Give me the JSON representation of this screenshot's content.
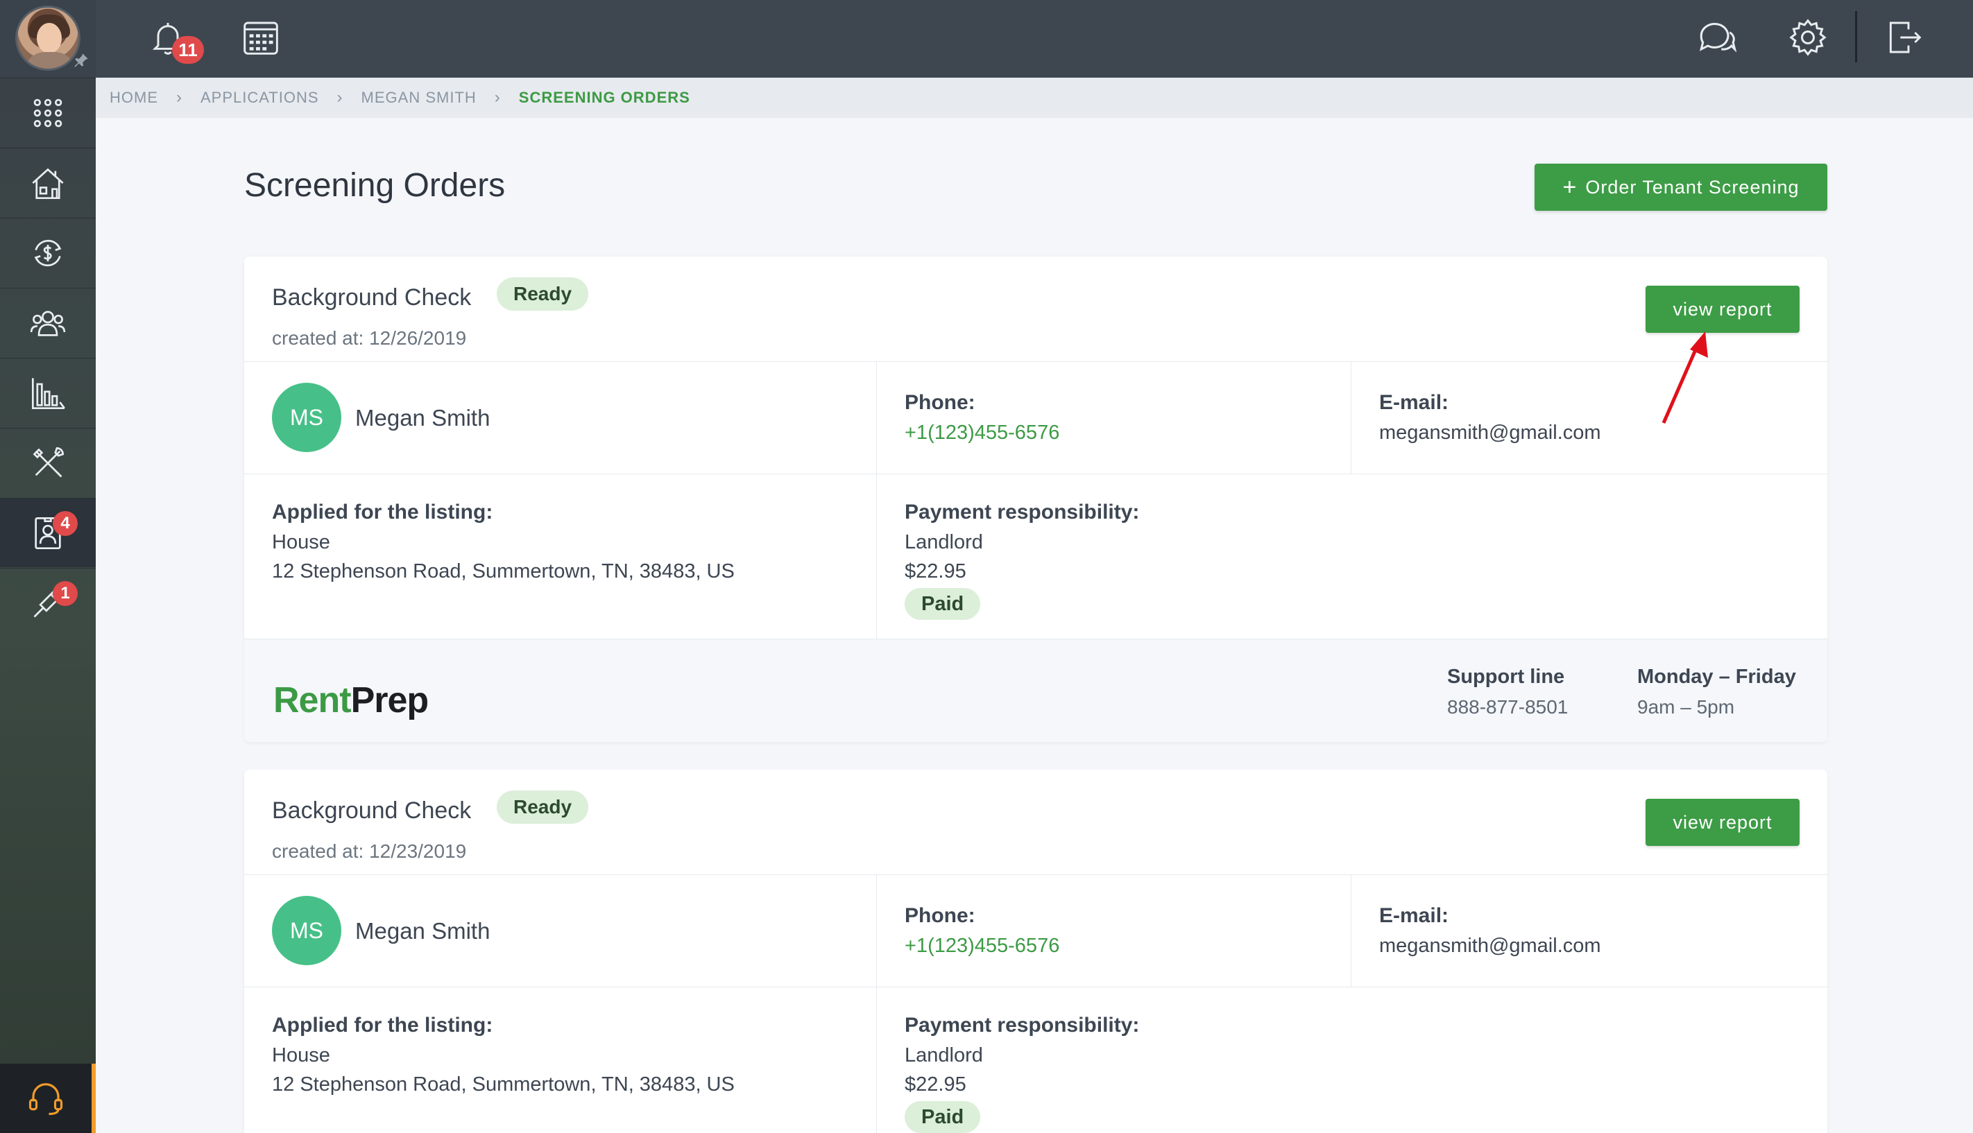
{
  "topbar": {
    "notification_count": "11"
  },
  "sidebar": {
    "items": [
      {
        "icon": "apps-grid-icon"
      },
      {
        "icon": "properties-icon"
      },
      {
        "icon": "accounting-icon"
      },
      {
        "icon": "people-icon"
      },
      {
        "icon": "reports-icon"
      },
      {
        "icon": "maintenance-icon"
      },
      {
        "icon": "applications-icon",
        "badge": "4"
      },
      {
        "icon": "tools-icon",
        "badge": "1"
      }
    ]
  },
  "breadcrumb": [
    "HOME",
    "APPLICATIONS",
    "MEGAN SMITH",
    "SCREENING ORDERS"
  ],
  "page": {
    "title": "Screening Orders",
    "order_button": "Order Tenant Screening"
  },
  "labels": {
    "phone": "Phone:",
    "email": "E-mail:",
    "listing": "Applied for the listing:",
    "payment": "Payment responsibility:",
    "view_report": "view report",
    "support_line": "Support line",
    "hours_label": "Monday – Friday"
  },
  "orders": [
    {
      "title": "Background Check",
      "status": "Ready",
      "created": "created at: 12/26/2019",
      "initials": "MS",
      "name": "Megan Smith",
      "phone": "+1(123)455-6576",
      "email": "megansmith@gmail.com",
      "listing_type": "House",
      "listing_address": "12 Stephenson Road, Summertown, TN, 38483, US",
      "payer": "Landlord",
      "amount": "$22.95",
      "payment_status": "Paid"
    },
    {
      "title": "Background Check",
      "status": "Ready",
      "created": "created at: 12/23/2019",
      "initials": "MS",
      "name": "Megan Smith",
      "phone": "+1(123)455-6576",
      "email": "megansmith@gmail.com",
      "listing_type": "House",
      "listing_address": "12 Stephenson Road, Summertown, TN, 38483, US",
      "payer": "Landlord",
      "amount": "$22.95",
      "payment_status": "Paid"
    }
  ],
  "provider": {
    "logo_rent": "Rent",
    "logo_prep": "Prep",
    "support_phone": "888-877-8501",
    "hours": "9am – 5pm"
  },
  "colors": {
    "accent": "#3d9c46",
    "badge": "#e04a4a",
    "annotation_arrow": "#e0101a"
  }
}
